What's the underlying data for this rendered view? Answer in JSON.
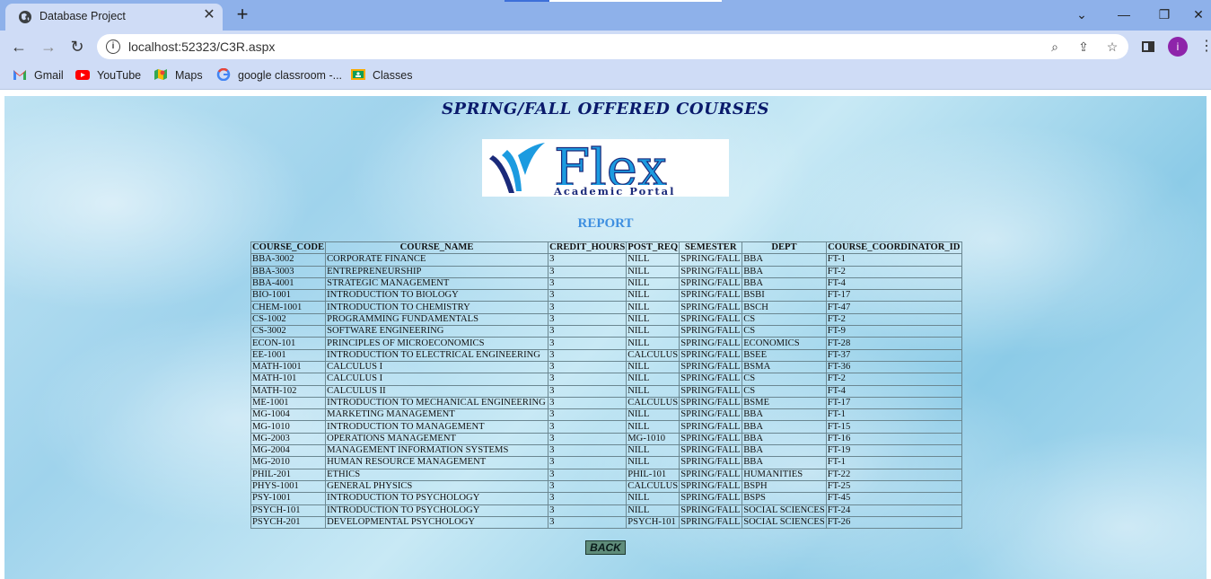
{
  "browser": {
    "tab_title": "Database Project",
    "url": "localhost:52323/C3R.aspx",
    "bookmarks": [
      {
        "label": "Gmail",
        "icon": "gmail-icon"
      },
      {
        "label": "YouTube",
        "icon": "youtube-icon"
      },
      {
        "label": "Maps",
        "icon": "maps-icon"
      },
      {
        "label": "google classroom -...",
        "icon": "google-icon"
      },
      {
        "label": "Classes",
        "icon": "classroom-icon"
      }
    ],
    "profile_initial": "i"
  },
  "page": {
    "title": "SPRING/FALL OFFERED COURSES",
    "logo_main": "Flex",
    "logo_sub": "Academic Portal",
    "report_label": "REPORT",
    "back_label": "BACK"
  },
  "table": {
    "headers": [
      "COURSE_CODE",
      "COURSE_NAME",
      "CREDIT_HOURS",
      "POST_REQ",
      "SEMESTER",
      "DEPT",
      "COURSE_COORDINATOR_ID"
    ],
    "rows": [
      [
        "BBA-3002",
        "CORPORATE FINANCE",
        "3",
        "NILL",
        "SPRING/FALL",
        "BBA",
        "FT-1"
      ],
      [
        "BBA-3003",
        "ENTREPRENEURSHIP",
        "3",
        "NILL",
        "SPRING/FALL",
        "BBA",
        "FT-2"
      ],
      [
        "BBA-4001",
        "STRATEGIC MANAGEMENT",
        "3",
        "NILL",
        "SPRING/FALL",
        "BBA",
        "FT-4"
      ],
      [
        "BIO-1001",
        "INTRODUCTION TO BIOLOGY",
        "3",
        "NILL",
        "SPRING/FALL",
        "BSBI",
        "FT-17"
      ],
      [
        "CHEM-1001",
        "INTRODUCTION TO CHEMISTRY",
        "3",
        "NILL",
        "SPRING/FALL",
        "BSCH",
        "FT-47"
      ],
      [
        "CS-1002",
        "PROGRAMMING FUNDAMENTALS",
        "3",
        "NILL",
        "SPRING/FALL",
        "CS",
        "FT-2"
      ],
      [
        "CS-3002",
        "SOFTWARE ENGINEERING",
        "3",
        "NILL",
        "SPRING/FALL",
        "CS",
        "FT-9"
      ],
      [
        "ECON-101",
        "PRINCIPLES OF MICROECONOMICS",
        "3",
        "NILL",
        "SPRING/FALL",
        "ECONOMICS",
        "FT-28"
      ],
      [
        "EE-1001",
        "INTRODUCTION TO ELECTRICAL ENGINEERING",
        "3",
        "CALCULUS",
        "SPRING/FALL",
        "BSEE",
        "FT-37"
      ],
      [
        "MATH-1001",
        "CALCULUS I",
        "3",
        "NILL",
        "SPRING/FALL",
        "BSMA",
        "FT-36"
      ],
      [
        "MATH-101",
        "CALCULUS I",
        "3",
        "NILL",
        "SPRING/FALL",
        "CS",
        "FT-2"
      ],
      [
        "MATH-102",
        "CALCULUS II",
        "3",
        "NILL",
        "SPRING/FALL",
        "CS",
        "FT-4"
      ],
      [
        "ME-1001",
        "INTRODUCTION TO MECHANICAL ENGINEERING",
        "3",
        "CALCULUS",
        "SPRING/FALL",
        "BSME",
        "FT-17"
      ],
      [
        "MG-1004",
        "MARKETING MANAGEMENT",
        "3",
        "NILL",
        "SPRING/FALL",
        "BBA",
        "FT-1"
      ],
      [
        "MG-1010",
        "INTRODUCTION TO MANAGEMENT",
        "3",
        "NILL",
        "SPRING/FALL",
        "BBA",
        "FT-15"
      ],
      [
        "MG-2003",
        "OPERATIONS MANAGEMENT",
        "3",
        "MG-1010",
        "SPRING/FALL",
        "BBA",
        "FT-16"
      ],
      [
        "MG-2004",
        "MANAGEMENT INFORMATION SYSTEMS",
        "3",
        "NILL",
        "SPRING/FALL",
        "BBA",
        "FT-19"
      ],
      [
        "MG-2010",
        "HUMAN RESOURCE MANAGEMENT",
        "3",
        "NILL",
        "SPRING/FALL",
        "BBA",
        "FT-1"
      ],
      [
        "PHIL-201",
        "ETHICS",
        "3",
        "PHIL-101",
        "SPRING/FALL",
        "HUMANITIES",
        "FT-22"
      ],
      [
        "PHYS-1001",
        "GENERAL PHYSICS",
        "3",
        "CALCULUS",
        "SPRING/FALL",
        "BSPH",
        "FT-25"
      ],
      [
        "PSY-1001",
        "INTRODUCTION TO PSYCHOLOGY",
        "3",
        "NILL",
        "SPRING/FALL",
        "BSPS",
        "FT-45"
      ],
      [
        "PSYCH-101",
        "INTRODUCTION TO PSYCHOLOGY",
        "3",
        "NILL",
        "SPRING/FALL",
        "SOCIAL SCIENCES",
        "FT-24"
      ],
      [
        "PSYCH-201",
        "DEVELOPMENTAL PSYCHOLOGY",
        "3",
        "PSYCH-101",
        "SPRING/FALL",
        "SOCIAL SCIENCES",
        "FT-26"
      ]
    ]
  },
  "colors": {
    "title": "#0a1a6b",
    "report": "#3e8fe0",
    "back_button": "#5f8c7a",
    "logo_blue": "#1c9be0",
    "logo_navy": "#1b2a7a"
  }
}
